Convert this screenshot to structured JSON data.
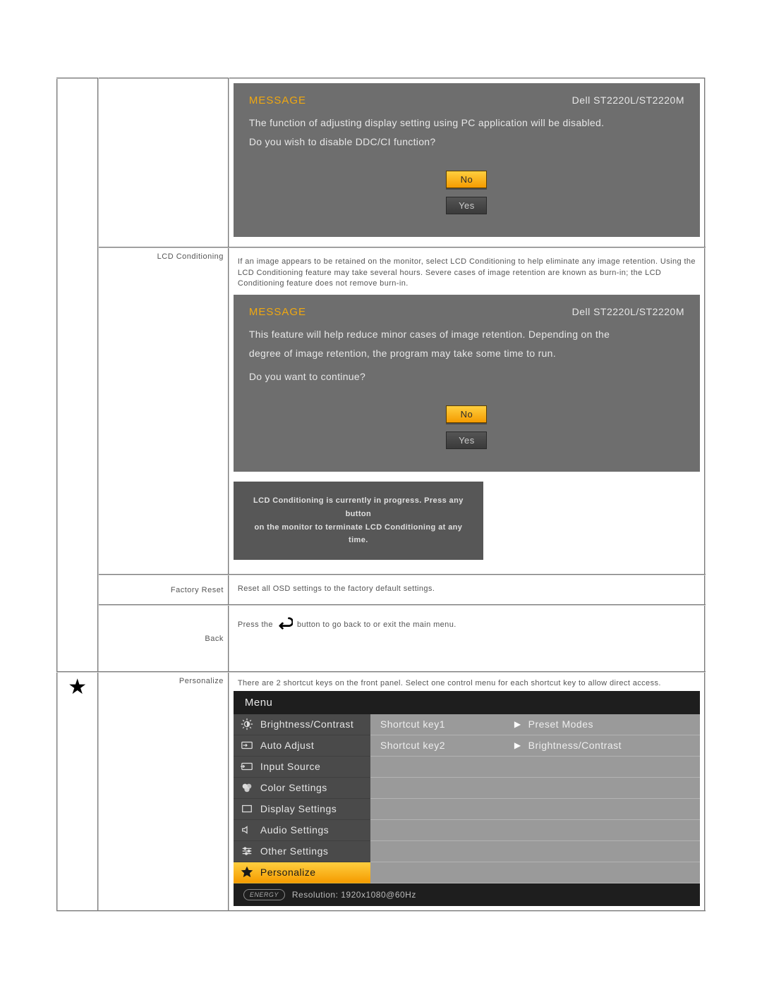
{
  "model": "Dell ST2220L/ST2220M",
  "rows": {
    "ddcci": {
      "dialog": {
        "title": "MESSAGE",
        "line1": "The function of adjusting display setting using PC application will be disabled.",
        "line2": "Do you wish to disable DDC/CI function?",
        "no": "No",
        "yes": "Yes"
      }
    },
    "lcd": {
      "label": "LCD Conditioning",
      "desc": "If an image appears to be retained on the monitor, select LCD Conditioning to help eliminate any image retention. Using the LCD Conditioning feature may take several hours. Severe cases of image retention are known as burn-in; the LCD Conditioning feature does not remove burn-in.",
      "dialog": {
        "title": "MESSAGE",
        "line1": "This feature will help reduce minor cases of image retention. Depending on the",
        "line2": "degree of image retention, the program may take some time to run.",
        "line3": "Do you want to continue?",
        "no": "No",
        "yes": "Yes"
      },
      "progress": {
        "l1": "LCD Conditioning is currently in progress. Press any button",
        "l2": "on the monitor to terminate LCD Conditioning at any time."
      }
    },
    "factory": {
      "label": "Factory Reset",
      "desc": "Reset all OSD settings to the factory default settings."
    },
    "back": {
      "label": "Back",
      "pre": "Press the",
      "post": "button to go back to or exit the main menu."
    },
    "personalize": {
      "label": "Personalize",
      "desc": "There are 2 shortcut keys on the front panel. Select one control menu for each shortcut key to allow direct access.",
      "menu": {
        "title": "Menu",
        "items": [
          "Brightness/Contrast",
          "Auto Adjust",
          "Input Source",
          "Color Settings",
          "Display Settings",
          "Audio Settings",
          "Other Settings",
          "Personalize"
        ],
        "right": {
          "r1_label": "Shortcut key1",
          "r1_value": "Preset Modes",
          "r2_label": "Shortcut key2",
          "r2_value": "Brightness/Contrast"
        },
        "footer_badge": "ENERGY",
        "footer": "Resolution: 1920x1080@60Hz"
      }
    }
  }
}
